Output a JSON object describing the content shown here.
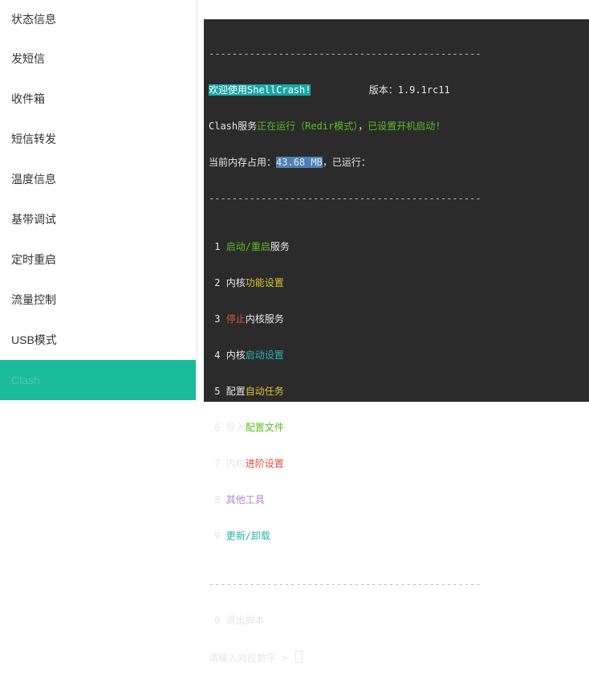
{
  "sidebar": {
    "items": [
      {
        "label": "状态信息"
      },
      {
        "label": "发短信"
      },
      {
        "label": "收件箱"
      },
      {
        "label": "短信转发"
      },
      {
        "label": "温度信息"
      },
      {
        "label": "基带调试"
      },
      {
        "label": "定时重启"
      },
      {
        "label": "流量控制"
      },
      {
        "label": "USB模式"
      },
      {
        "label": "Clash"
      }
    ]
  },
  "terminal": {
    "separator": "-----------------------------------------------",
    "welcome": "欢迎使用ShellCrash!",
    "version_label": "版本：1.9.1rc11",
    "status_clash": "Clash服务",
    "status_running": "正在运行（Redir模式）",
    "status_comma": "，",
    "status_autostart": "已设置开机启动!",
    "mem_label": "当前内存占用：",
    "mem_value": "43.68 MB",
    "uptime_label": "，已运行：",
    "menu": [
      {
        "num": " 1 ",
        "a": "启动/重启",
        "b": "服务",
        "a_color": "green"
      },
      {
        "num": " 2 ",
        "pre": "内核",
        "a": "功能设置",
        "a_color": "yellow"
      },
      {
        "num": " 3 ",
        "a": "停止",
        "b": "内核服务",
        "a_color": "red"
      },
      {
        "num": " 4 ",
        "pre": "内核",
        "a": "启动设置",
        "a_color": "cyan"
      },
      {
        "num": " 5 ",
        "pre": "配置",
        "a": "自动任务",
        "a_color": "yellow"
      },
      {
        "num": " 6 ",
        "pre": "导入",
        "a": "配置文件",
        "a_color": "green"
      },
      {
        "num": " 7 ",
        "pre": "内核",
        "a": "进阶设置",
        "a_color": "red"
      },
      {
        "num": " 8 ",
        "a": "其他工具",
        "a_color": "purple"
      },
      {
        "num": " 9 ",
        "a": "更新/卸载",
        "a_color": "cyan"
      }
    ],
    "exit_line": " 0 退出脚本",
    "prompt": "请输入对应数字 > "
  },
  "colors": {
    "accent": "#1abc9c",
    "terminal_bg": "#2b2b2b"
  }
}
